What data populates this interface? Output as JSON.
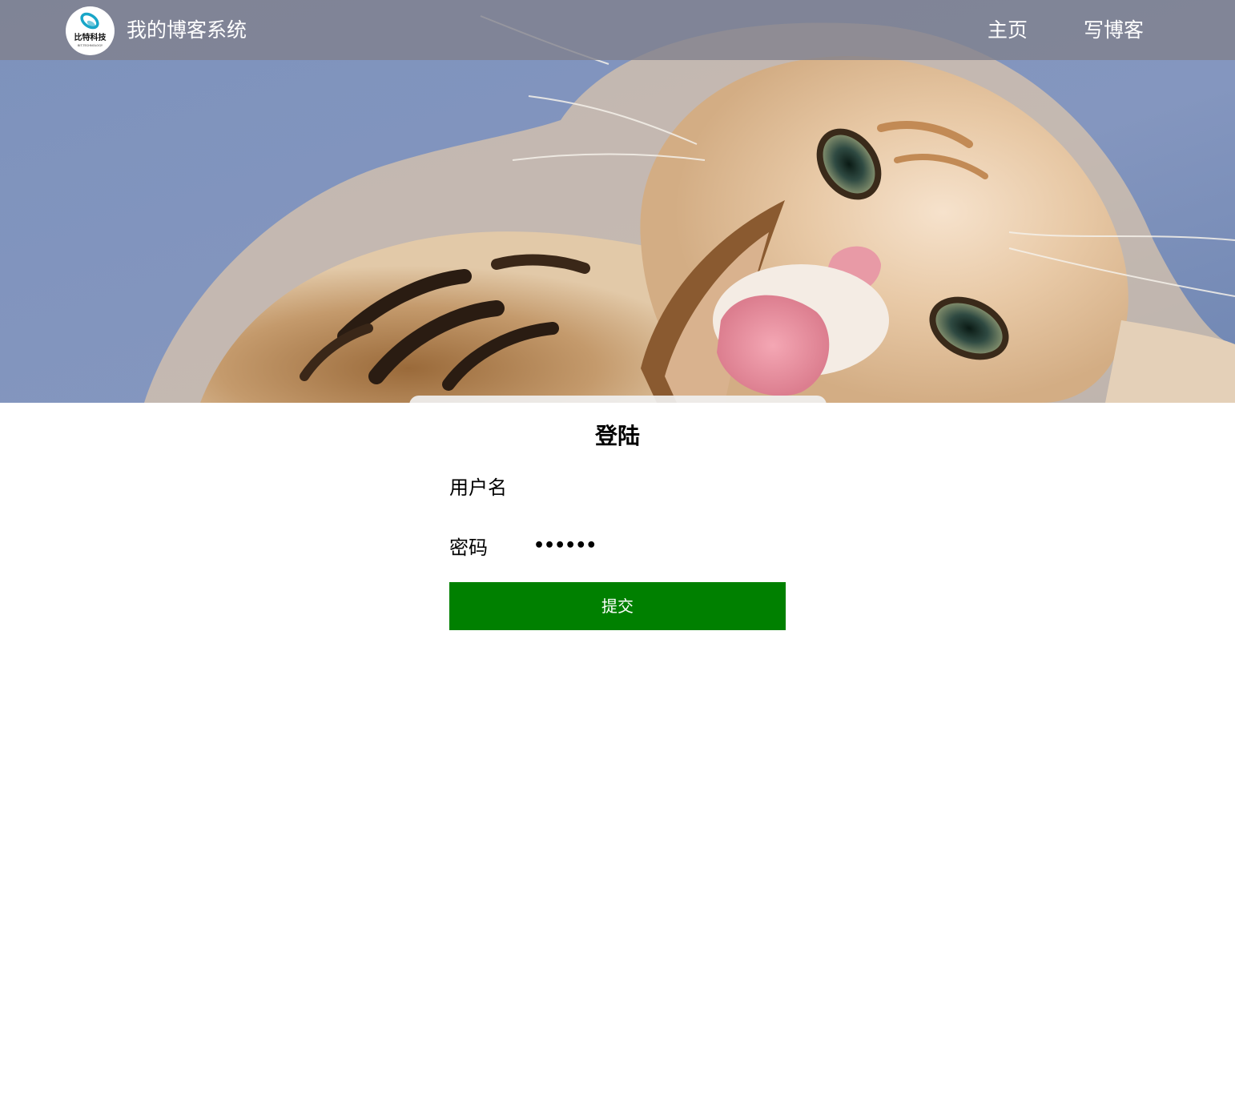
{
  "header": {
    "logo_text": "比特科技",
    "logo_subtext": "BIT-TECHNOLOGY",
    "site_title": "我的博客系统",
    "nav": {
      "home_label": "主页",
      "write_label": "写博客"
    },
    "bar_color": "#80808c"
  },
  "hero": {
    "image": "kitten-photo"
  },
  "login": {
    "title": "登陆",
    "username": {
      "label": "用户名",
      "value": ""
    },
    "password": {
      "label": "密码",
      "masked_value": "••••••"
    },
    "submit_label": "提交",
    "submit_color": "#008000"
  }
}
